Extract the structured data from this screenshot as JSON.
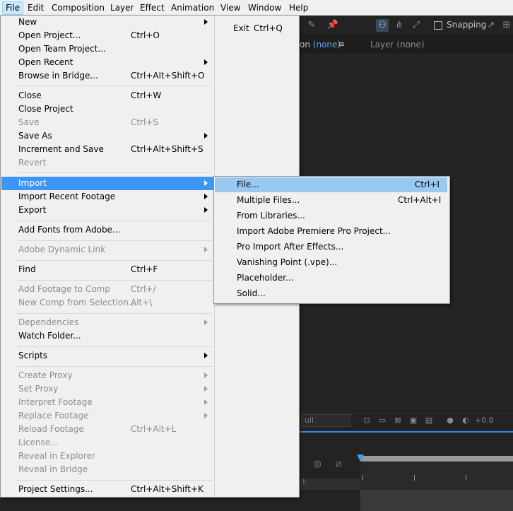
{
  "menubar": {
    "items": [
      "File",
      "Edit",
      "Composition",
      "Layer",
      "Effect",
      "Animation",
      "View",
      "Window",
      "Help"
    ]
  },
  "toolbar": {
    "snapping_label": "Snapping"
  },
  "panels": {
    "comp_tab_suffix": "on",
    "comp_tab_value": "(none)",
    "layer_tab_label": "Layer",
    "layer_tab_value": "(none)",
    "view_control_dropdown": "ull",
    "exposure_value": "+0.0",
    "timeline_label": "k"
  },
  "file_menu": {
    "items": [
      {
        "label": "New",
        "shortcut": "",
        "submenu": true,
        "disabled": false
      },
      {
        "label": "Open Project...",
        "shortcut": "Ctrl+O",
        "submenu": false,
        "disabled": false
      },
      {
        "label": "Open Team Project...",
        "shortcut": "",
        "submenu": false,
        "disabled": false
      },
      {
        "label": "Open Recent",
        "shortcut": "",
        "submenu": true,
        "disabled": false
      },
      {
        "label": "Browse in Bridge...",
        "shortcut": "Ctrl+Alt+Shift+O",
        "submenu": false,
        "disabled": false
      },
      {
        "label": "Close",
        "shortcut": "Ctrl+W",
        "submenu": false,
        "disabled": false
      },
      {
        "label": "Close Project",
        "shortcut": "",
        "submenu": false,
        "disabled": false
      },
      {
        "label": "Save",
        "shortcut": "Ctrl+S",
        "submenu": false,
        "disabled": true
      },
      {
        "label": "Save As",
        "shortcut": "",
        "submenu": true,
        "disabled": false
      },
      {
        "label": "Increment and Save",
        "shortcut": "Ctrl+Alt+Shift+S",
        "submenu": false,
        "disabled": false
      },
      {
        "label": "Revert",
        "shortcut": "",
        "submenu": false,
        "disabled": true
      },
      {
        "label": "Import",
        "shortcut": "",
        "submenu": true,
        "disabled": false,
        "highlighted": true
      },
      {
        "label": "Import Recent Footage",
        "shortcut": "",
        "submenu": true,
        "disabled": false
      },
      {
        "label": "Export",
        "shortcut": "",
        "submenu": true,
        "disabled": false
      },
      {
        "label": "Add Fonts from Adobe...",
        "shortcut": "",
        "submenu": false,
        "disabled": false
      },
      {
        "label": "Adobe Dynamic Link",
        "shortcut": "",
        "submenu": true,
        "disabled": true
      },
      {
        "label": "Find",
        "shortcut": "Ctrl+F",
        "submenu": false,
        "disabled": false
      },
      {
        "label": "Add Footage to Comp",
        "shortcut": "Ctrl+/",
        "submenu": false,
        "disabled": true
      },
      {
        "label": "New Comp from Selection...",
        "shortcut": "Alt+\\",
        "submenu": false,
        "disabled": true
      },
      {
        "label": "Dependencies",
        "shortcut": "",
        "submenu": true,
        "disabled": true
      },
      {
        "label": "Watch Folder...",
        "shortcut": "",
        "submenu": false,
        "disabled": false
      },
      {
        "label": "Scripts",
        "shortcut": "",
        "submenu": true,
        "disabled": false
      },
      {
        "label": "Create Proxy",
        "shortcut": "",
        "submenu": true,
        "disabled": true
      },
      {
        "label": "Set Proxy",
        "shortcut": "",
        "submenu": true,
        "disabled": true
      },
      {
        "label": "Interpret Footage",
        "shortcut": "",
        "submenu": true,
        "disabled": true
      },
      {
        "label": "Replace Footage",
        "shortcut": "",
        "submenu": true,
        "disabled": true
      },
      {
        "label": "Reload Footage",
        "shortcut": "Ctrl+Alt+L",
        "submenu": false,
        "disabled": true
      },
      {
        "label": "License...",
        "shortcut": "",
        "submenu": false,
        "disabled": true
      },
      {
        "label": "Reveal in Explorer",
        "shortcut": "",
        "submenu": false,
        "disabled": true
      },
      {
        "label": "Reveal in Bridge",
        "shortcut": "",
        "submenu": false,
        "disabled": true
      },
      {
        "label": "Project Settings...",
        "shortcut": "Ctrl+Alt+Shift+K",
        "submenu": false,
        "disabled": false
      }
    ],
    "exit": {
      "label": "Exit",
      "shortcut": "Ctrl+Q"
    }
  },
  "import_submenu": {
    "items": [
      {
        "label": "File...",
        "shortcut": "Ctrl+I",
        "highlighted": true
      },
      {
        "label": "Multiple Files...",
        "shortcut": "Ctrl+Alt+I"
      },
      {
        "label": "From Libraries...",
        "shortcut": ""
      },
      {
        "label": "Import Adobe Premiere Pro Project...",
        "shortcut": ""
      },
      {
        "label": "Pro Import After Effects...",
        "shortcut": ""
      },
      {
        "label": "Vanishing Point (.vpe)...",
        "shortcut": ""
      },
      {
        "label": "Placeholder...",
        "shortcut": ""
      },
      {
        "label": "Solid...",
        "shortcut": ""
      }
    ]
  }
}
